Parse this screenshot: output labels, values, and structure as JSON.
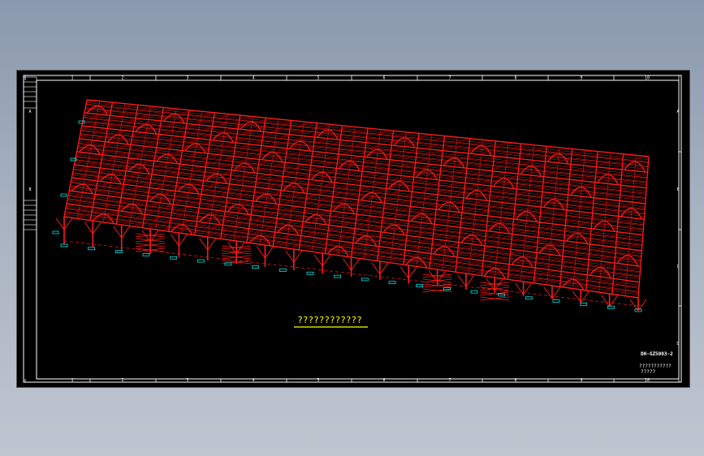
{
  "drawing": {
    "title": "????????????",
    "drawing_number": "DH-GZ5003-2",
    "company_line": "???????????",
    "sub_line": "?????"
  },
  "frame": {
    "top_columns": [
      "1",
      "2",
      "3",
      "4",
      "5",
      "6",
      "7",
      "8",
      "9",
      "10"
    ],
    "bottom_columns": [
      "1",
      "2",
      "3",
      "4",
      "5",
      "6",
      "7",
      "8",
      "9",
      "10"
    ],
    "right_rows": [
      "A",
      "B",
      "C",
      "D"
    ],
    "left_rows": [
      "A",
      "B"
    ]
  },
  "colors": {
    "background": "#000000",
    "frame": "#ffffff",
    "structure": "#ff1a1a",
    "title_text": "#ffff00",
    "tags": "#00ffff"
  },
  "column_tag_count": 22
}
